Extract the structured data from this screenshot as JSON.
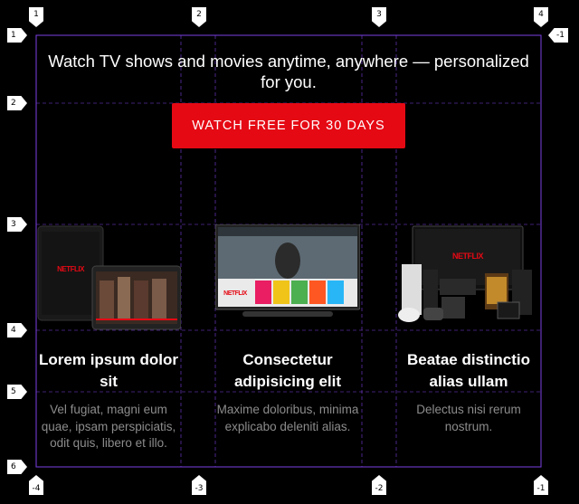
{
  "hero": {
    "title": "Watch TV shows and movies anytime, anywhere — personalized for you.",
    "cta_label": "WATCH FREE FOR 30 DAYS"
  },
  "brand": {
    "logo_text": "NETFLIX",
    "accent": "#e50914",
    "grid_color": "#7b3fe4"
  },
  "features": [
    {
      "title": "Lorem ipsum dolor sit",
      "text": "Vel fugiat, magni eum quae, ipsam perspiciatis, odit quis, libero et illo.",
      "device": "tablet-phone"
    },
    {
      "title": "Consectetur adipisicing elit",
      "text": "Maxime doloribus, minima explicabo deleniti alias.",
      "device": "smart-tv"
    },
    {
      "title": "Beatae distinctio alias ullam",
      "text": "Delectus nisi rerum nostrum.",
      "device": "consoles"
    }
  ],
  "grid_labels": {
    "top": [
      "1",
      "2",
      "3",
      "4"
    ],
    "bottom": [
      "-4",
      "-3",
      "-2",
      "-1"
    ],
    "left": [
      "1",
      "2",
      "3",
      "4",
      "5",
      "6"
    ],
    "right": [
      "-1"
    ]
  }
}
